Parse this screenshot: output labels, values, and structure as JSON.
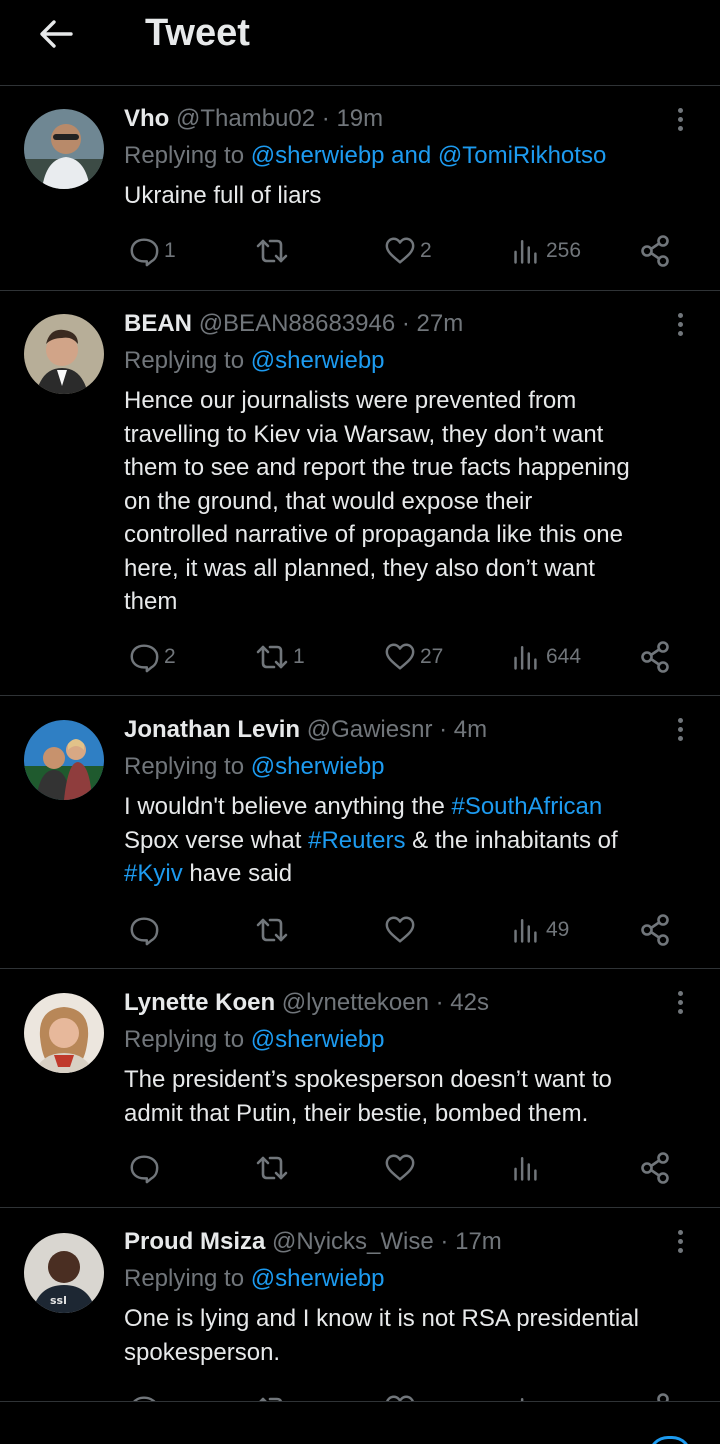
{
  "header": {
    "title": "Tweet"
  },
  "tweets": [
    {
      "name": "Vho",
      "handle": "@Thambu02",
      "time": "19m",
      "replying_prefix": "Replying to",
      "replying_mentions": "@sherwiebp and @TomiRikhotso",
      "text_parts": [
        "Ukraine full of liars"
      ],
      "stats": {
        "replies": "1",
        "retweets": "",
        "likes": "2",
        "views": "256"
      }
    },
    {
      "name": "BEAN",
      "handle": "@BEAN88683946",
      "time": "27m",
      "replying_prefix": "Replying to",
      "replying_mentions": "@sherwiebp",
      "text_lines": [
        "Hence our journalists were prevented from",
        "travelling to Kiev via Warsaw, they don’t want",
        "them to see and report the true facts happening",
        "on the ground, that would expose their",
        "controlled narrative of propaganda like this one",
        "here, it was all planned, they also don’t want",
        "them"
      ],
      "stats": {
        "replies": "2",
        "retweets": "1",
        "likes": "27",
        "views": "644"
      }
    },
    {
      "name": "Jonathan Levin",
      "handle": "@Gawiesnr",
      "time": "4m",
      "replying_prefix": "Replying to",
      "replying_mentions": "@sherwiebp",
      "text": {
        "l1a": "I wouldn't believe anything the ",
        "l1b": "#SouthAfrican",
        "l2a": "Spox verse what ",
        "l2b": "#Reuters",
        "l2c": " & the inhabitants of",
        "l3a": "#Kyiv",
        "l3b": " have said"
      },
      "stats": {
        "replies": "",
        "retweets": "",
        "likes": "",
        "views": "49"
      }
    },
    {
      "name": "Lynette Koen",
      "handle": "@lynettekoen",
      "time": "42s",
      "replying_prefix": "Replying to",
      "replying_mentions": "@sherwiebp",
      "text_lines": [
        "The president’s spokesperson doesn’t want to",
        "admit that Putin, their bestie, bombed them."
      ],
      "stats": {
        "replies": "",
        "retweets": "",
        "likes": "",
        "views": ""
      }
    },
    {
      "name": "Proud Msiza",
      "handle": "@Nyicks_Wise",
      "time": "17m",
      "replying_prefix": "Replying to",
      "replying_mentions": "@sherwiebp",
      "text_lines": [
        "One is lying and I know it is not RSA presidential",
        "spokesperson."
      ]
    }
  ],
  "separator": "·",
  "colors": {
    "background": "#000000",
    "text": "#e7e9ea",
    "muted": "#71767b",
    "accent": "#1d9bf0",
    "divider": "#2f3336"
  },
  "icons": {
    "back": "arrow-left-icon",
    "more": "more-vertical-icon",
    "reply": "reply-bubble-icon",
    "retweet": "retweet-icon",
    "like": "heart-icon",
    "views": "views-bars-icon",
    "share": "share-icon"
  }
}
